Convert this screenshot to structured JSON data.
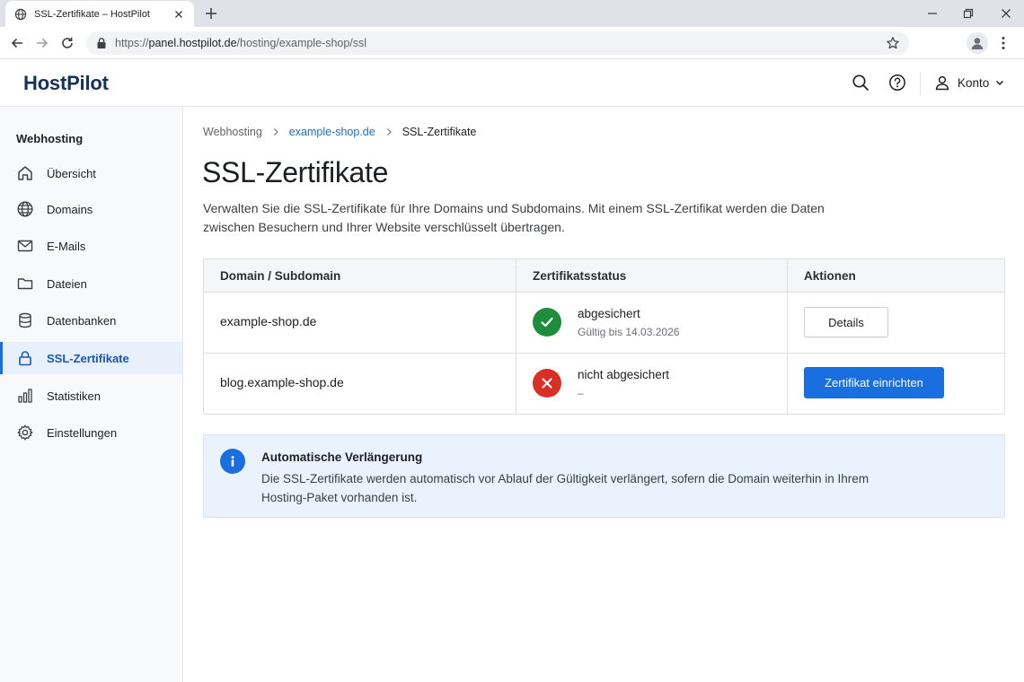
{
  "browser": {
    "tab_title": "SSL-Zertifikate – HostPilot",
    "url_prefix": "https://",
    "url_host": "panel.hostpilot.de",
    "url_path": "/hosting/example-shop/ssl"
  },
  "header": {
    "logo": "HostPilot",
    "account_label": "Konto"
  },
  "sidebar": {
    "heading": "Webhosting",
    "items": [
      {
        "label": "Übersicht",
        "icon": "home-icon"
      },
      {
        "label": "Domains",
        "icon": "globe-icon"
      },
      {
        "label": "E-Mails",
        "icon": "mail-icon"
      },
      {
        "label": "Dateien",
        "icon": "folder-icon"
      },
      {
        "label": "Datenbanken",
        "icon": "database-icon"
      },
      {
        "label": "SSL-Zertifikate",
        "icon": "lock-icon",
        "active": true
      },
      {
        "label": "Statistiken",
        "icon": "bar-chart-icon"
      },
      {
        "label": "Einstellungen",
        "icon": "gear-icon"
      }
    ]
  },
  "breadcrumb": [
    "Webhosting",
    "example-shop.de",
    "SSL-Zertifikate"
  ],
  "page": {
    "title": "SSL-Zertifikate",
    "description": "Verwalten Sie die SSL-Zertifikate für Ihre Domains und Subdomains. Mit einem SSL-Zertifikat werden die Daten zwischen Besuchern und Ihrer Website verschlüsselt übertragen."
  },
  "table": {
    "headers": [
      "Domain / Subdomain",
      "Zertifikatsstatus",
      "Aktionen"
    ],
    "rows": [
      {
        "domain": "example-shop.de",
        "status": "abgesichert",
        "sub": "Gültig bis 14.03.2026",
        "action": "Details",
        "state": "ok"
      },
      {
        "domain": "blog.example-shop.de",
        "status": "nicht abgesichert",
        "sub": "–",
        "action": "Zertifikat einrichten",
        "state": "error"
      }
    ]
  },
  "info": {
    "title": "Automatische Verlängerung",
    "text": "Die SSL-Zertifikate werden automatisch vor Ablauf der Gültigkeit verlängert, sofern die Domain weiterhin in Ihrem Hosting-Paket vorhanden ist."
  },
  "colors": {
    "accent": "#1a6fe0",
    "success": "#1e8e3e",
    "error": "#d93025",
    "logo": "#13325c"
  }
}
